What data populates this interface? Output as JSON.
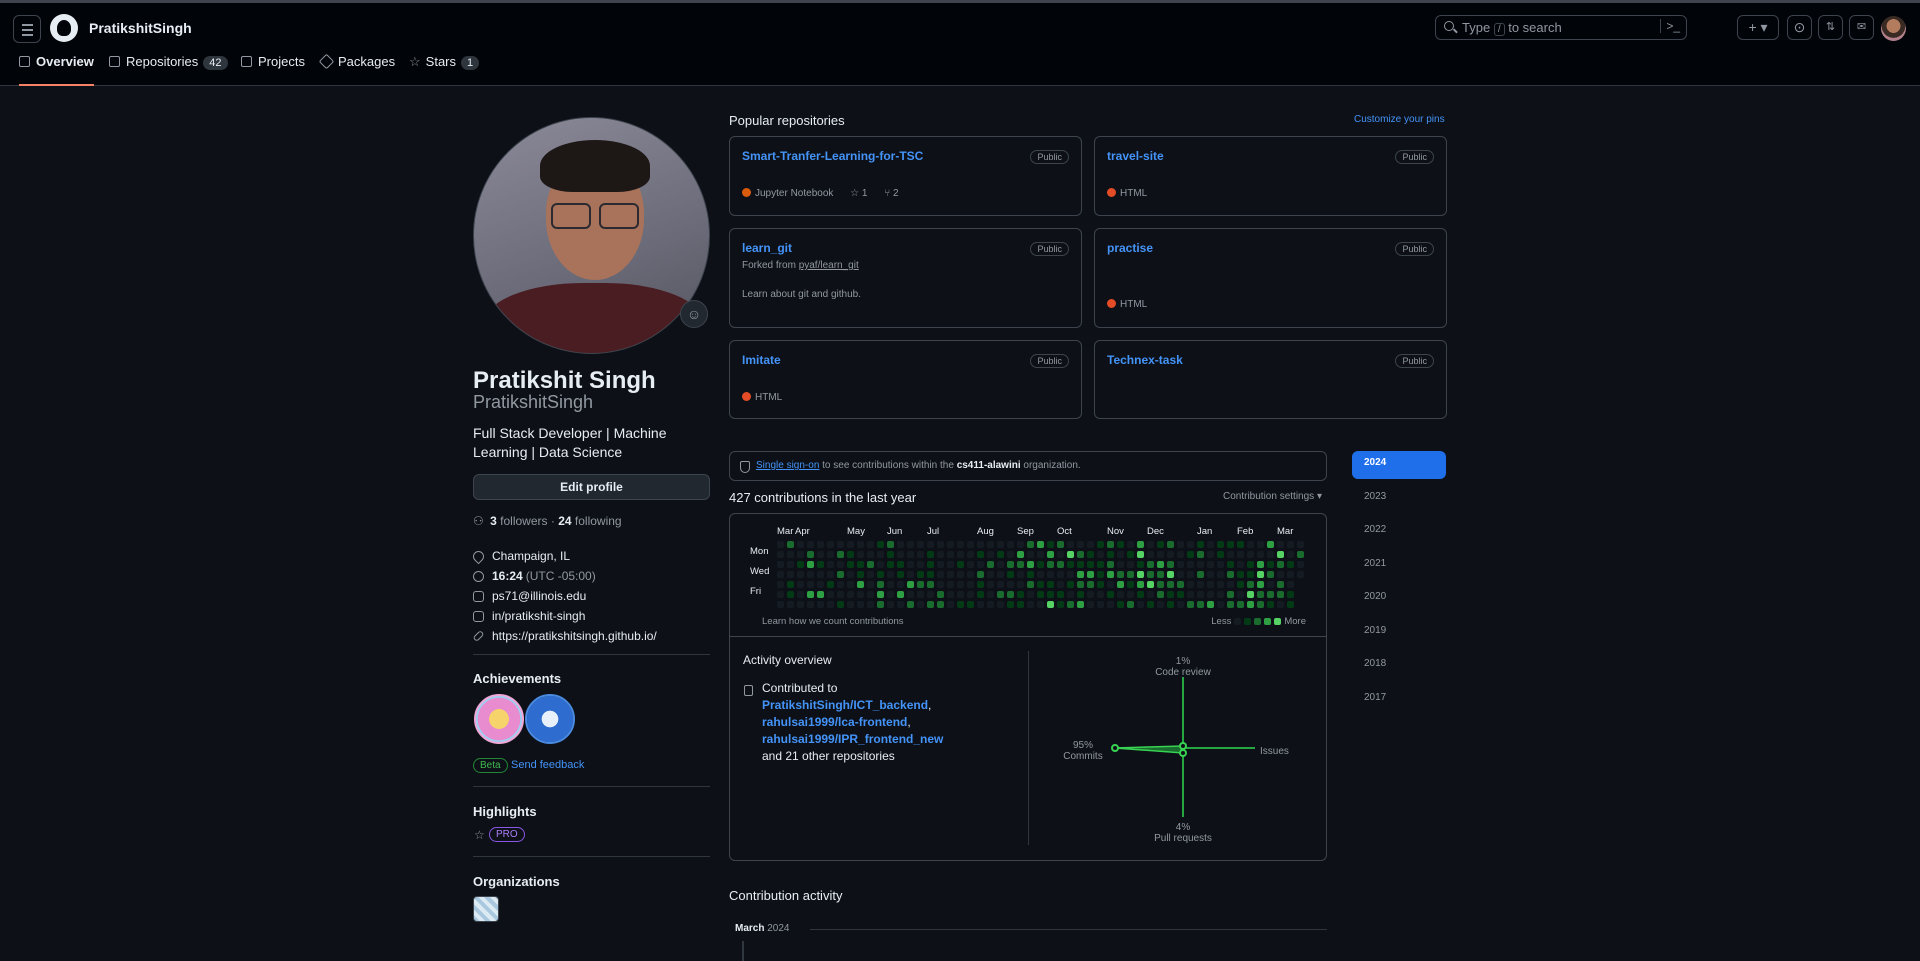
{
  "header": {
    "context": "PratikshitSingh",
    "search_placeholder_prefix": "Type",
    "search_key": "/",
    "search_placeholder_suffix": "to search",
    "plus_label": "+ ▾"
  },
  "tabs": [
    {
      "label": "Overview",
      "active": true
    },
    {
      "label": "Repositories",
      "count": "42"
    },
    {
      "label": "Projects"
    },
    {
      "label": "Packages"
    },
    {
      "label": "Stars",
      "count": "1"
    }
  ],
  "profile": {
    "name": "Pratikshit Singh",
    "login": "PratikshitSingh",
    "bio": "Full Stack Developer | Machine Learning | Data Science",
    "edit_label": "Edit profile",
    "followers_count": "3",
    "followers_label": "followers",
    "sep": "·",
    "following_count": "24",
    "following_label": "following",
    "location": "Champaign, IL",
    "time": "16:24",
    "timezone": "(UTC -05:00)",
    "email": "ps71@illinois.edu",
    "linkedin": "in/pratikshit-singh",
    "website": "https://pratikshitsingh.github.io/",
    "achievements_title": "Achievements",
    "beta_label": "Beta",
    "feedback_label": "Send feedback",
    "highlights_title": "Highlights",
    "pro_label": "PRO",
    "organizations_title": "Organizations"
  },
  "popular": {
    "title": "Popular repositories",
    "customize": "Customize your pins",
    "repos": [
      {
        "name": "Smart-Tranfer-Learning-for-TSC",
        "visibility": "Public",
        "language": "Jupyter Notebook",
        "lang_color": "#DA5B0B",
        "stars": "1",
        "forks": "2"
      },
      {
        "name": "travel-site",
        "visibility": "Public",
        "language": "HTML",
        "lang_color": "#e34c26"
      },
      {
        "name": "learn_git",
        "visibility": "Public",
        "forked_prefix": "Forked from",
        "forked_from": "pyaf/learn_git",
        "description": "Learn about git and github."
      },
      {
        "name": "practise",
        "visibility": "Public",
        "language": "HTML",
        "lang_color": "#e34c26"
      },
      {
        "name": "Imitate",
        "visibility": "Public",
        "language": "HTML",
        "lang_color": "#e34c26"
      },
      {
        "name": "Technex-task",
        "visibility": "Public"
      }
    ]
  },
  "sso": {
    "link": "Single sign-on",
    "text1": "to see contributions within the",
    "org": "cs411-alawini",
    "text2": "organization."
  },
  "contributions": {
    "summary": "427 contributions in the last year",
    "settings": "Contribution settings ▾",
    "months": [
      "Mar",
      "Apr",
      "May",
      "Jun",
      "Jul",
      "Aug",
      "Sep",
      "Oct",
      "Nov",
      "Dec",
      "Jan",
      "Feb",
      "Mar"
    ],
    "days": [
      "Mon",
      "Wed",
      "Fri"
    ],
    "learn": "Learn how we count contributions",
    "less": "Less",
    "more": "More",
    "colors": [
      "#151b23",
      "#033a16",
      "#196c2e",
      "#2ea043",
      "#56d364"
    ]
  },
  "activity": {
    "title": "Activity overview",
    "contributed_to": "Contributed to",
    "repo1": "PratikshitSingh/ICT_backend",
    "repo2": "rahulsai1999/lca-frontend",
    "repo3": "rahulsai1999/IPR_frontend_new",
    "other": "and 21 other repositories",
    "code_review_pct": "1%",
    "code_review": "Code review",
    "commits_pct": "95%",
    "commits": "Commits",
    "issues": "Issues",
    "pr_pct": "4%",
    "pr": "Pull requests"
  },
  "years": [
    "2024",
    "2023",
    "2022",
    "2021",
    "2020",
    "2019",
    "2018",
    "2017"
  ],
  "contribution_activity": {
    "title": "Contribution activity",
    "month": "March",
    "year": "2024"
  }
}
